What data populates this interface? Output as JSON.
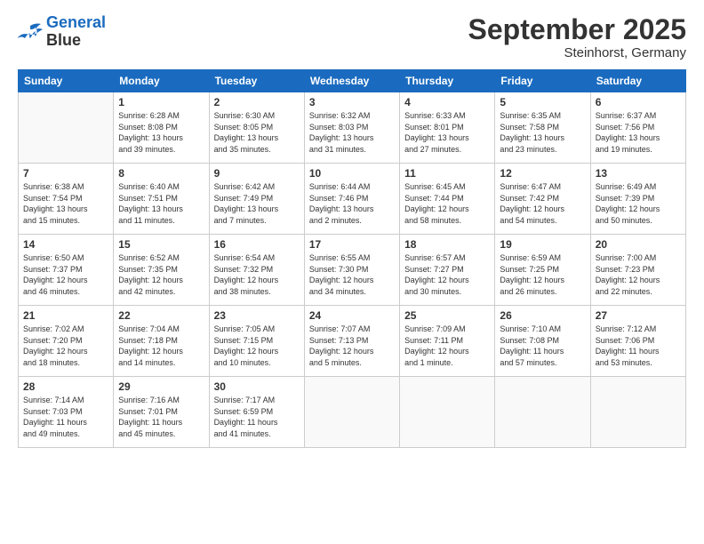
{
  "header": {
    "logo_line1": "General",
    "logo_line2": "Blue",
    "month": "September 2025",
    "location": "Steinhorst, Germany"
  },
  "days_of_week": [
    "Sunday",
    "Monday",
    "Tuesday",
    "Wednesday",
    "Thursday",
    "Friday",
    "Saturday"
  ],
  "weeks": [
    [
      {
        "num": "",
        "info": ""
      },
      {
        "num": "1",
        "info": "Sunrise: 6:28 AM\nSunset: 8:08 PM\nDaylight: 13 hours\nand 39 minutes."
      },
      {
        "num": "2",
        "info": "Sunrise: 6:30 AM\nSunset: 8:05 PM\nDaylight: 13 hours\nand 35 minutes."
      },
      {
        "num": "3",
        "info": "Sunrise: 6:32 AM\nSunset: 8:03 PM\nDaylight: 13 hours\nand 31 minutes."
      },
      {
        "num": "4",
        "info": "Sunrise: 6:33 AM\nSunset: 8:01 PM\nDaylight: 13 hours\nand 27 minutes."
      },
      {
        "num": "5",
        "info": "Sunrise: 6:35 AM\nSunset: 7:58 PM\nDaylight: 13 hours\nand 23 minutes."
      },
      {
        "num": "6",
        "info": "Sunrise: 6:37 AM\nSunset: 7:56 PM\nDaylight: 13 hours\nand 19 minutes."
      }
    ],
    [
      {
        "num": "7",
        "info": "Sunrise: 6:38 AM\nSunset: 7:54 PM\nDaylight: 13 hours\nand 15 minutes."
      },
      {
        "num": "8",
        "info": "Sunrise: 6:40 AM\nSunset: 7:51 PM\nDaylight: 13 hours\nand 11 minutes."
      },
      {
        "num": "9",
        "info": "Sunrise: 6:42 AM\nSunset: 7:49 PM\nDaylight: 13 hours\nand 7 minutes."
      },
      {
        "num": "10",
        "info": "Sunrise: 6:44 AM\nSunset: 7:46 PM\nDaylight: 13 hours\nand 2 minutes."
      },
      {
        "num": "11",
        "info": "Sunrise: 6:45 AM\nSunset: 7:44 PM\nDaylight: 12 hours\nand 58 minutes."
      },
      {
        "num": "12",
        "info": "Sunrise: 6:47 AM\nSunset: 7:42 PM\nDaylight: 12 hours\nand 54 minutes."
      },
      {
        "num": "13",
        "info": "Sunrise: 6:49 AM\nSunset: 7:39 PM\nDaylight: 12 hours\nand 50 minutes."
      }
    ],
    [
      {
        "num": "14",
        "info": "Sunrise: 6:50 AM\nSunset: 7:37 PM\nDaylight: 12 hours\nand 46 minutes."
      },
      {
        "num": "15",
        "info": "Sunrise: 6:52 AM\nSunset: 7:35 PM\nDaylight: 12 hours\nand 42 minutes."
      },
      {
        "num": "16",
        "info": "Sunrise: 6:54 AM\nSunset: 7:32 PM\nDaylight: 12 hours\nand 38 minutes."
      },
      {
        "num": "17",
        "info": "Sunrise: 6:55 AM\nSunset: 7:30 PM\nDaylight: 12 hours\nand 34 minutes."
      },
      {
        "num": "18",
        "info": "Sunrise: 6:57 AM\nSunset: 7:27 PM\nDaylight: 12 hours\nand 30 minutes."
      },
      {
        "num": "19",
        "info": "Sunrise: 6:59 AM\nSunset: 7:25 PM\nDaylight: 12 hours\nand 26 minutes."
      },
      {
        "num": "20",
        "info": "Sunrise: 7:00 AM\nSunset: 7:23 PM\nDaylight: 12 hours\nand 22 minutes."
      }
    ],
    [
      {
        "num": "21",
        "info": "Sunrise: 7:02 AM\nSunset: 7:20 PM\nDaylight: 12 hours\nand 18 minutes."
      },
      {
        "num": "22",
        "info": "Sunrise: 7:04 AM\nSunset: 7:18 PM\nDaylight: 12 hours\nand 14 minutes."
      },
      {
        "num": "23",
        "info": "Sunrise: 7:05 AM\nSunset: 7:15 PM\nDaylight: 12 hours\nand 10 minutes."
      },
      {
        "num": "24",
        "info": "Sunrise: 7:07 AM\nSunset: 7:13 PM\nDaylight: 12 hours\nand 5 minutes."
      },
      {
        "num": "25",
        "info": "Sunrise: 7:09 AM\nSunset: 7:11 PM\nDaylight: 12 hours\nand 1 minute."
      },
      {
        "num": "26",
        "info": "Sunrise: 7:10 AM\nSunset: 7:08 PM\nDaylight: 11 hours\nand 57 minutes."
      },
      {
        "num": "27",
        "info": "Sunrise: 7:12 AM\nSunset: 7:06 PM\nDaylight: 11 hours\nand 53 minutes."
      }
    ],
    [
      {
        "num": "28",
        "info": "Sunrise: 7:14 AM\nSunset: 7:03 PM\nDaylight: 11 hours\nand 49 minutes."
      },
      {
        "num": "29",
        "info": "Sunrise: 7:16 AM\nSunset: 7:01 PM\nDaylight: 11 hours\nand 45 minutes."
      },
      {
        "num": "30",
        "info": "Sunrise: 7:17 AM\nSunset: 6:59 PM\nDaylight: 11 hours\nand 41 minutes."
      },
      {
        "num": "",
        "info": ""
      },
      {
        "num": "",
        "info": ""
      },
      {
        "num": "",
        "info": ""
      },
      {
        "num": "",
        "info": ""
      }
    ]
  ]
}
